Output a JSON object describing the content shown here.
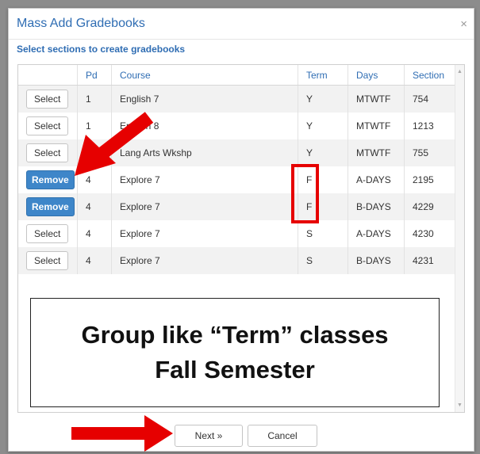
{
  "modal": {
    "title": "Mass Add Gradebooks",
    "close_glyph": "×",
    "subtitle": "Select sections to create gradebooks"
  },
  "table": {
    "headers": [
      "",
      "Pd",
      "Course",
      "Term",
      "Days",
      "Section"
    ],
    "rows": [
      {
        "action": "Select",
        "pd": "1",
        "course": "English 7",
        "term": "Y",
        "days": "MTWTF",
        "section": "754"
      },
      {
        "action": "Select",
        "pd": "1",
        "course": "English 8",
        "term": "Y",
        "days": "MTWTF",
        "section": "1213"
      },
      {
        "action": "Select",
        "pd": "1",
        "course": "Lang Arts Wkshp",
        "term": "Y",
        "days": "MTWTF",
        "section": "755"
      },
      {
        "action": "Remove",
        "pd": "4",
        "course": "Explore 7",
        "term": "F",
        "days": "A-DAYS",
        "section": "2195"
      },
      {
        "action": "Remove",
        "pd": "4",
        "course": "Explore 7",
        "term": "F",
        "days": "B-DAYS",
        "section": "4229"
      },
      {
        "action": "Select",
        "pd": "4",
        "course": "Explore 7",
        "term": "S",
        "days": "A-DAYS",
        "section": "4230"
      },
      {
        "action": "Select",
        "pd": "4",
        "course": "Explore 7",
        "term": "S",
        "days": "B-DAYS",
        "section": "4231"
      }
    ]
  },
  "annotation": {
    "line1": "Group like “Term” classes",
    "line2": "Fall Semester"
  },
  "footer": {
    "next_label": "Next »",
    "cancel_label": "Cancel"
  },
  "colors": {
    "title_blue": "#2f6db3",
    "remove_button": "#3e86c9",
    "annotation_red": "#e60000"
  },
  "icons": [
    "close-icon",
    "scroll-up-icon",
    "scroll-down-icon",
    "red-arrow-icon"
  ]
}
